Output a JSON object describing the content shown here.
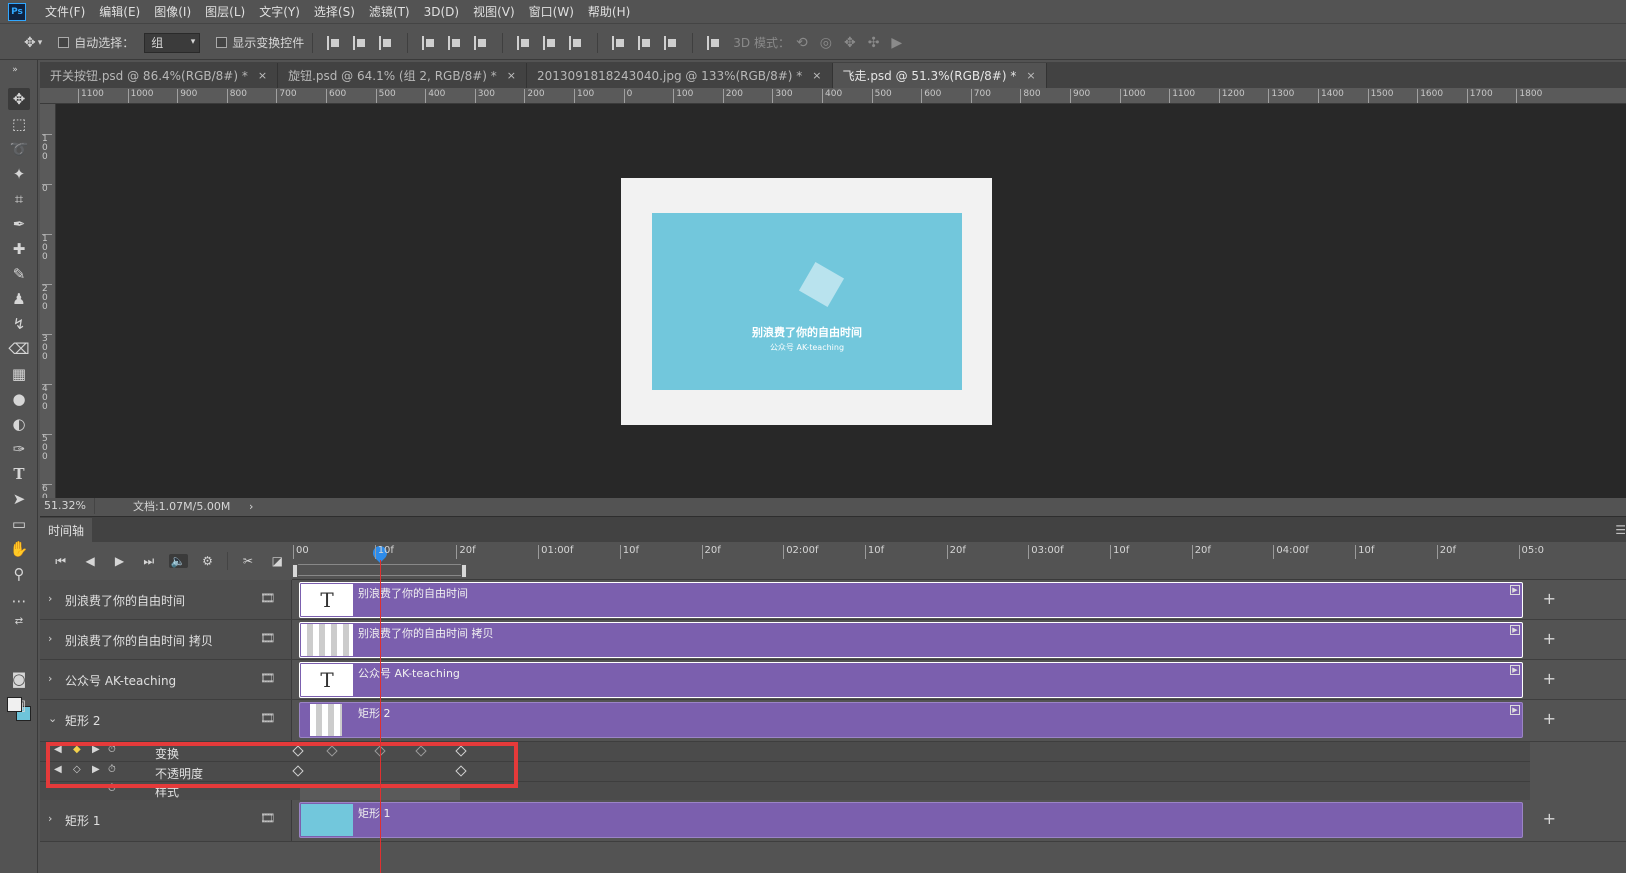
{
  "app": {
    "logo": "Ps"
  },
  "menu": [
    "文件(F)",
    "编辑(E)",
    "图像(I)",
    "图层(L)",
    "文字(Y)",
    "选择(S)",
    "滤镜(T)",
    "3D(D)",
    "视图(V)",
    "窗口(W)",
    "帮助(H)"
  ],
  "options": {
    "auto_select_label": "自动选择：",
    "auto_select_value": "组",
    "show_transform_label": "显示变换控件",
    "mode_3d_label": "3D 模式："
  },
  "tabs": [
    {
      "label": "开关按钮.psd @ 86.4%(RGB/8#) *",
      "close": "×"
    },
    {
      "label": "旋钮.psd @ 64.1% (组 2, RGB/8#) *",
      "close": "×"
    },
    {
      "label": "2013091818243040.jpg @ 133%(RGB/8#) *",
      "close": "×"
    },
    {
      "label": "飞走.psd @ 51.3%(RGB/8#) *",
      "close": "×"
    }
  ],
  "ruler_h": [
    "1100",
    "1000",
    "900",
    "800",
    "700",
    "600",
    "500",
    "400",
    "300",
    "200",
    "100",
    "0",
    "100",
    "200",
    "300",
    "400",
    "500",
    "600",
    "700",
    "800",
    "900",
    "1000",
    "1100",
    "1200",
    "1300",
    "1400",
    "1500",
    "1600",
    "1700",
    "1800"
  ],
  "ruler_v": [
    "100",
    "0",
    "100",
    "200",
    "300",
    "400",
    "500",
    "600"
  ],
  "canvas": {
    "line1": "别浪费了你的自由时间",
    "line2": "公众号   AK-teaching",
    "doc_bg": "#f2f2f2",
    "panel_color": "#72c7dc"
  },
  "status": {
    "zoom": "51.32%",
    "doc": "文档:1.07M/5.00M",
    "arrow": "›"
  },
  "timeline": {
    "tab": "时间轴",
    "ticks": [
      "00",
      "10f",
      "20f",
      "01:00f",
      "10f",
      "20f",
      "02:00f",
      "10f",
      "20f",
      "03:00f",
      "10f",
      "20f",
      "04:00f",
      "10f",
      "20f",
      "05:0"
    ],
    "tracks": [
      {
        "name": "别浪费了你的自由时间",
        "clip": "别浪费了你的自由时间",
        "thumb": "T"
      },
      {
        "name": "别浪费了你的自由时间 拷贝",
        "clip": "别浪费了你的自由时间 拷贝",
        "thumb": ""
      },
      {
        "name": "公众号    AK-teaching",
        "clip": "公众号    AK-teaching",
        "thumb": "T"
      },
      {
        "name": "矩形 2",
        "clip": "矩形 2",
        "thumb": ""
      },
      {
        "name": "矩形 1",
        "clip": "矩形 1",
        "thumb": ""
      }
    ],
    "properties": [
      {
        "name": "变换"
      },
      {
        "name": "不透明度"
      },
      {
        "name": "样式"
      }
    ],
    "accent_colors": {
      "clip": "#7b5fae",
      "playhead": "#e03030",
      "highlight": "#e53a3a"
    }
  }
}
